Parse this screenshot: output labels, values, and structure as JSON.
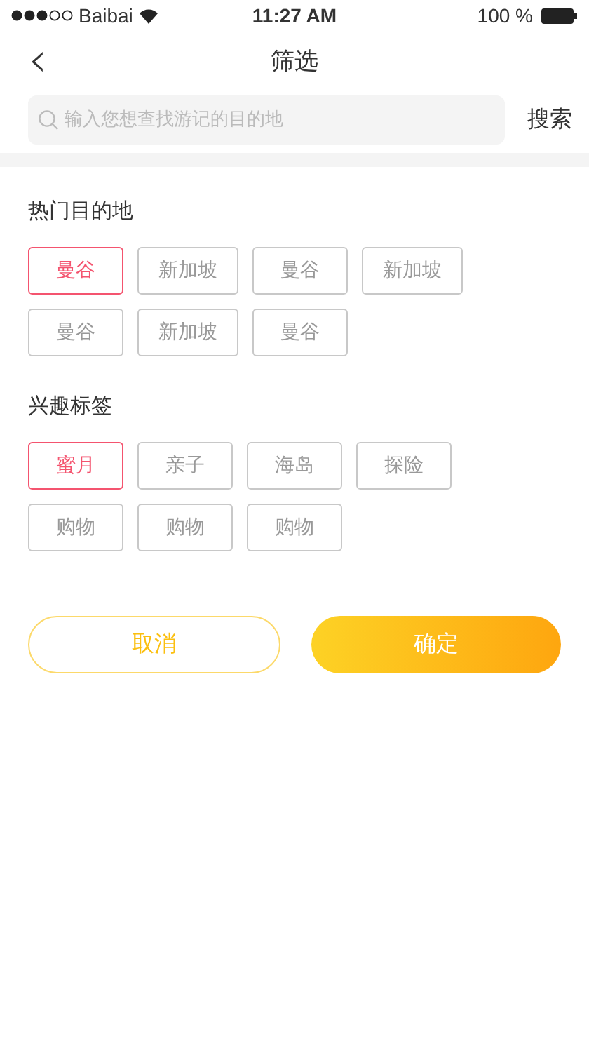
{
  "status_bar": {
    "carrier": "Baibai",
    "time": "11:27 AM",
    "battery": "100 %"
  },
  "nav": {
    "back": "‹",
    "title": "筛选"
  },
  "search": {
    "placeholder": "输入您想查找游记的目的地",
    "button": "搜索"
  },
  "sections": [
    {
      "title": "热门目的地",
      "tags": [
        {
          "label": "曼谷",
          "selected": true
        },
        {
          "label": "新加坡",
          "selected": false
        },
        {
          "label": "曼谷",
          "selected": false
        },
        {
          "label": "新加坡",
          "selected": false
        },
        {
          "label": "曼谷",
          "selected": false
        },
        {
          "label": "新加坡",
          "selected": false
        },
        {
          "label": "曼谷",
          "selected": false
        }
      ]
    },
    {
      "title": "兴趣标签",
      "tags": [
        {
          "label": "蜜月",
          "selected": true
        },
        {
          "label": "亲子",
          "selected": false
        },
        {
          "label": "海岛",
          "selected": false
        },
        {
          "label": "探险",
          "selected": false
        },
        {
          "label": "购物",
          "selected": false
        },
        {
          "label": "购物",
          "selected": false
        },
        {
          "label": "购物",
          "selected": false
        }
      ]
    }
  ],
  "actions": {
    "cancel": "取消",
    "confirm": "确定"
  }
}
